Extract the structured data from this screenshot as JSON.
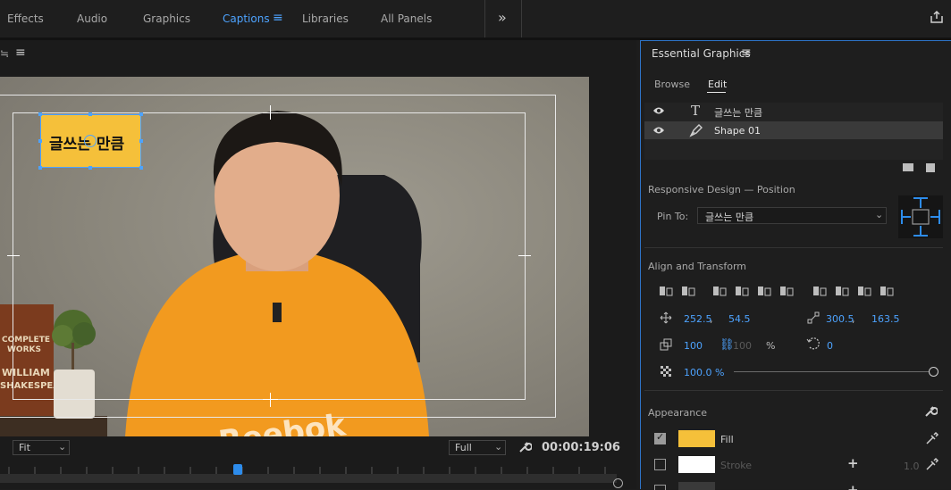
{
  "topbar": {
    "tabs": [
      "Effects",
      "Audio",
      "Graphics",
      "Captions",
      "Libraries",
      "All Panels"
    ],
    "active_tab": "Captions",
    "more_label": "»"
  },
  "program": {
    "menu_glyph": "≡",
    "title_text": "글쓰는 만큼",
    "fit_label": "Fit",
    "quality_label": "Full",
    "timecode": "00:00:19:06",
    "shirt_text": "Reebok",
    "book_text_1": "COMPLETE",
    "book_text_2": "WORKS",
    "book_text_3": "WILLIAM",
    "book_text_4": "SHAKESPEARE",
    "playhead_fraction": 0.385
  },
  "essential_graphics": {
    "title": "Essential Graphics",
    "tabs": [
      "Browse",
      "Edit"
    ],
    "active_tab": "Edit",
    "layers": [
      {
        "icon": "text-icon",
        "label": "글쓰는 만큼",
        "selected": false
      },
      {
        "icon": "pen-icon",
        "label": "Shape 01",
        "selected": true
      }
    ],
    "responsive_heading": "Responsive Design — Position",
    "pin_label": "Pin To:",
    "pin_value": "글쓰는 만큼",
    "align_heading": "Align and Transform",
    "position_x": "252.5",
    "position_y": "54.5",
    "anchor_x": "300.5",
    "anchor_y": "163.5",
    "scale": "100",
    "scale_height": "100",
    "percent_sign": "%",
    "rotation": "0",
    "opacity": "100.0 %",
    "comma": ",",
    "appearance_heading": "Appearance",
    "fill_label": "Fill",
    "stroke_label": "Stroke",
    "stroke_width": "1.0",
    "fill_color": "#f5c03a",
    "stroke_color": "#ffffff",
    "fill_checked": true,
    "stroke_checked": false
  },
  "colors": {
    "accent": "#4da3ff",
    "highlight_box": "#f5c03a"
  }
}
